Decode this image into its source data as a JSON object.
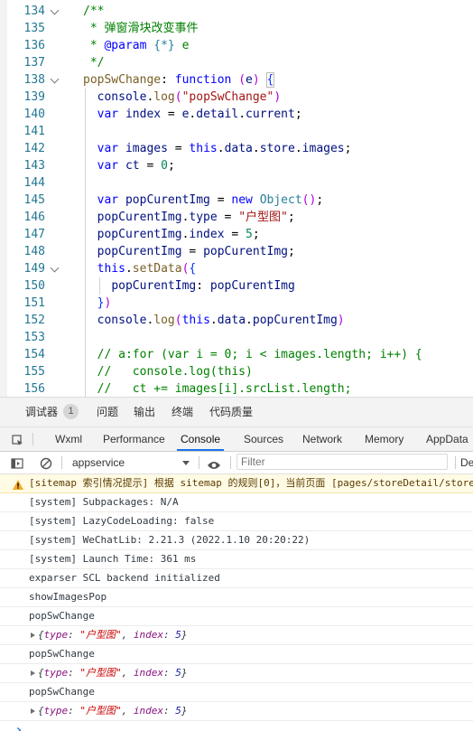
{
  "editor": {
    "lines": [
      {
        "num": "134",
        "fold": true,
        "tokens": [
          [
            "c-com",
            "/**"
          ]
        ]
      },
      {
        "num": "135",
        "fold": false,
        "tokens": [
          [
            "c-com",
            " * 弹窗滑块改变事件"
          ]
        ]
      },
      {
        "num": "136",
        "fold": false,
        "tokens": [
          [
            "c-com",
            " * "
          ],
          [
            "c-kw",
            "@param"
          ],
          [
            "c-com",
            " "
          ],
          [
            "c-ctor",
            "{*}"
          ],
          [
            "c-com",
            " e"
          ]
        ]
      },
      {
        "num": "137",
        "fold": false,
        "tokens": [
          [
            "c-com",
            " */"
          ]
        ]
      },
      {
        "num": "138",
        "fold": true,
        "tokens": [
          [
            "c-fn",
            "popSwChange"
          ],
          [
            "c-punc",
            ": "
          ],
          [
            "c-kw",
            "function"
          ],
          [
            "c-punc",
            " "
          ],
          [
            "c-paren",
            "("
          ],
          [
            "c-var",
            "e"
          ],
          [
            "c-paren",
            ")"
          ],
          [
            "c-punc",
            " "
          ],
          [
            "c-brace",
            "{"
          ]
        ]
      },
      {
        "num": "139",
        "fold": false,
        "tokens": [
          [
            "c-punc",
            "  "
          ],
          [
            "c-var",
            "console"
          ],
          [
            "c-punc",
            "."
          ],
          [
            "c-fn",
            "log"
          ],
          [
            "c-paren",
            "("
          ],
          [
            "c-str",
            "\"popSwChange\""
          ],
          [
            "c-paren",
            ")"
          ]
        ]
      },
      {
        "num": "140",
        "fold": false,
        "tokens": [
          [
            "c-punc",
            "  "
          ],
          [
            "c-kw",
            "var"
          ],
          [
            "c-punc",
            " "
          ],
          [
            "c-var",
            "index"
          ],
          [
            "c-punc",
            " = "
          ],
          [
            "c-var",
            "e"
          ],
          [
            "c-punc",
            "."
          ],
          [
            "c-var",
            "detail"
          ],
          [
            "c-punc",
            "."
          ],
          [
            "c-var",
            "current"
          ],
          [
            "c-punc",
            ";"
          ]
        ]
      },
      {
        "num": "141",
        "fold": false,
        "tokens": []
      },
      {
        "num": "142",
        "fold": false,
        "tokens": [
          [
            "c-punc",
            "  "
          ],
          [
            "c-kw",
            "var"
          ],
          [
            "c-punc",
            " "
          ],
          [
            "c-var",
            "images"
          ],
          [
            "c-punc",
            " = "
          ],
          [
            "c-kw",
            "this"
          ],
          [
            "c-punc",
            "."
          ],
          [
            "c-var",
            "data"
          ],
          [
            "c-punc",
            "."
          ],
          [
            "c-var",
            "store"
          ],
          [
            "c-punc",
            "."
          ],
          [
            "c-var",
            "images"
          ],
          [
            "c-punc",
            ";"
          ]
        ]
      },
      {
        "num": "143",
        "fold": false,
        "tokens": [
          [
            "c-punc",
            "  "
          ],
          [
            "c-kw",
            "var"
          ],
          [
            "c-punc",
            " "
          ],
          [
            "c-var",
            "ct"
          ],
          [
            "c-punc",
            " = "
          ],
          [
            "c-num",
            "0"
          ],
          [
            "c-punc",
            ";"
          ]
        ]
      },
      {
        "num": "144",
        "fold": false,
        "tokens": []
      },
      {
        "num": "145",
        "fold": false,
        "tokens": [
          [
            "c-punc",
            "  "
          ],
          [
            "c-kw",
            "var"
          ],
          [
            "c-punc",
            " "
          ],
          [
            "c-var",
            "popCurentImg"
          ],
          [
            "c-punc",
            " = "
          ],
          [
            "c-kw",
            "new"
          ],
          [
            "c-punc",
            " "
          ],
          [
            "c-ctor",
            "Object"
          ],
          [
            "c-paren",
            "()"
          ],
          [
            "c-punc",
            ";"
          ]
        ]
      },
      {
        "num": "146",
        "fold": false,
        "tokens": [
          [
            "c-punc",
            "  "
          ],
          [
            "c-var",
            "popCurentImg"
          ],
          [
            "c-punc",
            "."
          ],
          [
            "c-var",
            "type"
          ],
          [
            "c-punc",
            " = "
          ],
          [
            "c-str",
            "\"户型图\""
          ],
          [
            "c-punc",
            ";"
          ]
        ]
      },
      {
        "num": "147",
        "fold": false,
        "tokens": [
          [
            "c-punc",
            "  "
          ],
          [
            "c-var",
            "popCurentImg"
          ],
          [
            "c-punc",
            "."
          ],
          [
            "c-var",
            "index"
          ],
          [
            "c-punc",
            " = "
          ],
          [
            "c-num",
            "5"
          ],
          [
            "c-punc",
            ";"
          ]
        ]
      },
      {
        "num": "148",
        "fold": false,
        "tokens": [
          [
            "c-punc",
            "  "
          ],
          [
            "c-var",
            "popCurentImg"
          ],
          [
            "c-punc",
            " = "
          ],
          [
            "c-var",
            "popCurentImg"
          ],
          [
            "c-punc",
            ";"
          ]
        ]
      },
      {
        "num": "149",
        "fold": true,
        "tokens": [
          [
            "c-punc",
            "  "
          ],
          [
            "c-kw",
            "this"
          ],
          [
            "c-punc",
            "."
          ],
          [
            "c-fn",
            "setData"
          ],
          [
            "c-paren",
            "("
          ],
          [
            "c-brace",
            "{"
          ]
        ]
      },
      {
        "num": "150",
        "fold": false,
        "tokens": [
          [
            "c-punc",
            "    "
          ],
          [
            "c-var",
            "popCurentImg"
          ],
          [
            "c-punc",
            ": "
          ],
          [
            "c-var",
            "popCurentImg"
          ]
        ]
      },
      {
        "num": "151",
        "fold": false,
        "tokens": [
          [
            "c-punc",
            "  "
          ],
          [
            "c-brace",
            "}"
          ],
          [
            "c-paren",
            ")"
          ]
        ]
      },
      {
        "num": "152",
        "fold": false,
        "tokens": [
          [
            "c-punc",
            "  "
          ],
          [
            "c-var",
            "console"
          ],
          [
            "c-punc",
            "."
          ],
          [
            "c-fn",
            "log"
          ],
          [
            "c-paren",
            "("
          ],
          [
            "c-kw",
            "this"
          ],
          [
            "c-punc",
            "."
          ],
          [
            "c-var",
            "data"
          ],
          [
            "c-punc",
            "."
          ],
          [
            "c-var",
            "popCurentImg"
          ],
          [
            "c-paren",
            ")"
          ]
        ]
      },
      {
        "num": "153",
        "fold": false,
        "tokens": []
      },
      {
        "num": "154",
        "fold": false,
        "tokens": [
          [
            "c-com",
            "  // a:for (var i = 0; i < images.length; i++) {"
          ]
        ]
      },
      {
        "num": "155",
        "fold": false,
        "tokens": [
          [
            "c-com",
            "  //   console.log(this)"
          ]
        ]
      },
      {
        "num": "156",
        "fold": false,
        "tokens": [
          [
            "c-com",
            "  //   ct += images[i].srcList.length;"
          ]
        ]
      }
    ]
  },
  "devtools": {
    "outer_tabs": [
      {
        "label": "调试器",
        "badge": "1"
      },
      {
        "label": "问题"
      },
      {
        "label": "输出"
      },
      {
        "label": "终端"
      },
      {
        "label": "代码质量"
      }
    ],
    "inner_tabs": [
      "Wxml",
      "Performance",
      "Console",
      "Sources",
      "Network",
      "Memory",
      "AppData"
    ],
    "active_inner_tab": "Console",
    "toolbar": {
      "context": "appservice",
      "filter_placeholder": "Filter",
      "levels_truncated": "De"
    },
    "console": [
      {
        "type": "warn",
        "text": "[sitemap 索引情况提示] 根据 sitemap 的规则[0]，当前页面 [pages/storeDetail/storeDetail] 将被索引"
      },
      {
        "type": "log",
        "text": "[system] Subpackages: N/A"
      },
      {
        "type": "log",
        "text": "[system] LazyCodeLoading: false"
      },
      {
        "type": "log",
        "text": "[system] WeChatLib: 2.21.3 (2022.1.10 20:20:22)"
      },
      {
        "type": "log",
        "text": "[system] Launch Time: 361 ms"
      },
      {
        "type": "log",
        "text": "exparser SCL backend initialized"
      },
      {
        "type": "log",
        "text": "showImagesPop"
      },
      {
        "type": "log",
        "text": "popSwChange"
      },
      {
        "type": "obj",
        "open": "{",
        "k1": "type",
        "v1": "\"户型图\"",
        "k2": "index",
        "v2": "5",
        "close": "}"
      },
      {
        "type": "log",
        "text": "popSwChange"
      },
      {
        "type": "obj",
        "open": "{",
        "k1": "type",
        "v1": "\"户型图\"",
        "k2": "index",
        "v2": "5",
        "close": "}"
      },
      {
        "type": "log",
        "text": "popSwChange"
      },
      {
        "type": "obj",
        "open": "{",
        "k1": "type",
        "v1": "\"户型图\"",
        "k2": "index",
        "v2": "5",
        "close": "}"
      }
    ],
    "prompt": "›"
  }
}
